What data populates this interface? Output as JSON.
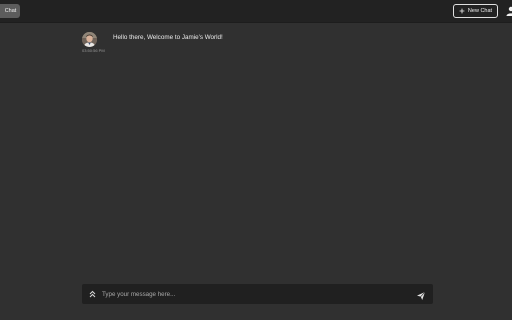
{
  "header": {
    "tab_label": "Chat",
    "new_chat_label": "New Chat",
    "new_chat_icon": "plus-icon",
    "user_icon": "user-icon"
  },
  "messages": [
    {
      "text": "Hello there, Welcome to Jamie's World!",
      "time": "03:50:56 PM",
      "avatar": "avatar"
    }
  ],
  "composer": {
    "placeholder": "Type your message here...",
    "value": "",
    "expand_icon": "chevron-double-up-icon",
    "send_icon": "send-icon"
  },
  "colors": {
    "background": "#303030",
    "topbar": "#222222",
    "composer": "#202020",
    "text": "#ececec"
  }
}
